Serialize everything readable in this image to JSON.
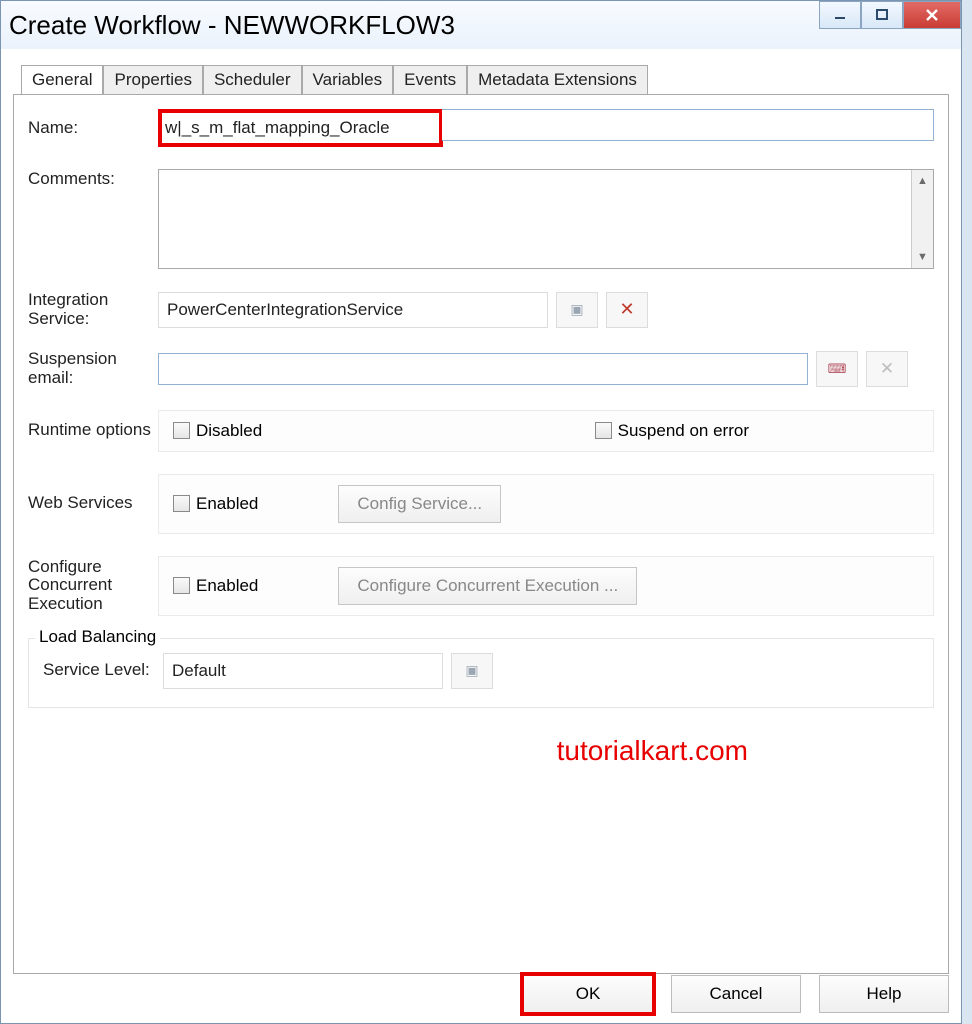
{
  "window": {
    "title": "Create Workflow - NEWWORKFLOW3"
  },
  "tabs": [
    "General",
    "Properties",
    "Scheduler",
    "Variables",
    "Events",
    "Metadata Extensions"
  ],
  "form": {
    "name_label": "Name:",
    "name_value": "w|_s_m_flat_mapping_Oracle",
    "comments_label": "Comments:",
    "comments_value": "",
    "integration_label": "Integration Service:",
    "integration_value": "PowerCenterIntegrationService",
    "suspension_label": "Suspension email:",
    "suspension_value": "",
    "runtime_label": "Runtime options",
    "disabled_label": "Disabled",
    "suspend_label": "Suspend on error",
    "web_services_label": "Web Services",
    "web_enabled_label": "Enabled",
    "config_service_btn": "Config Service...",
    "cce_label": "Configure Concurrent Execution",
    "cce_enabled_label": "Enabled",
    "cce_btn": "Configure Concurrent Execution ...",
    "load_balancing_legend": "Load Balancing",
    "service_level_label": "Service Level:",
    "service_level_value": "Default"
  },
  "buttons": {
    "ok": "OK",
    "cancel": "Cancel",
    "help": "Help"
  },
  "watermark": "tutorialkart.com"
}
